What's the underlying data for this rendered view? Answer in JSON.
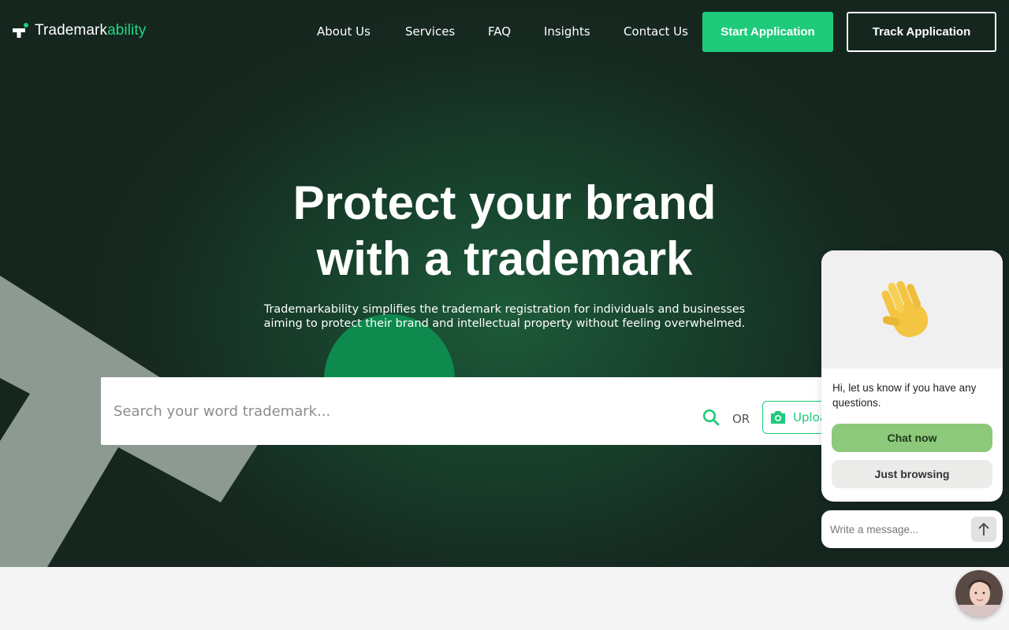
{
  "brand": {
    "logo_text_main": "Trademark",
    "logo_text_accent": "ability",
    "accent_color": "#1ecb7a"
  },
  "nav": {
    "links": [
      "About Us",
      "Services",
      "FAQ",
      "Insights",
      "Contact Us"
    ],
    "start_label": "Start Application",
    "track_label": "Track Application"
  },
  "hero": {
    "headline_line1": "Protect your brand",
    "headline_line2": "with a trademark",
    "subtext_line1": "Trademarkability simplifies the trademark registration for individuals and businesses",
    "subtext_line2": "aiming to protect their brand and intellectual property without feeling overwhelmed."
  },
  "search": {
    "placeholder": "Search your word trademark...",
    "or_label": "OR",
    "upload_label": "Upload",
    "search_icon": "search-icon",
    "upload_icon": "camera-icon"
  },
  "chat": {
    "icon": "waving-hand-icon",
    "message": "Hi, let us know if you have any questions.",
    "chat_now_label": "Chat now",
    "just_browsing_label": "Just browsing",
    "input_placeholder": "Write a message...",
    "send_icon": "arrow-up-icon"
  }
}
